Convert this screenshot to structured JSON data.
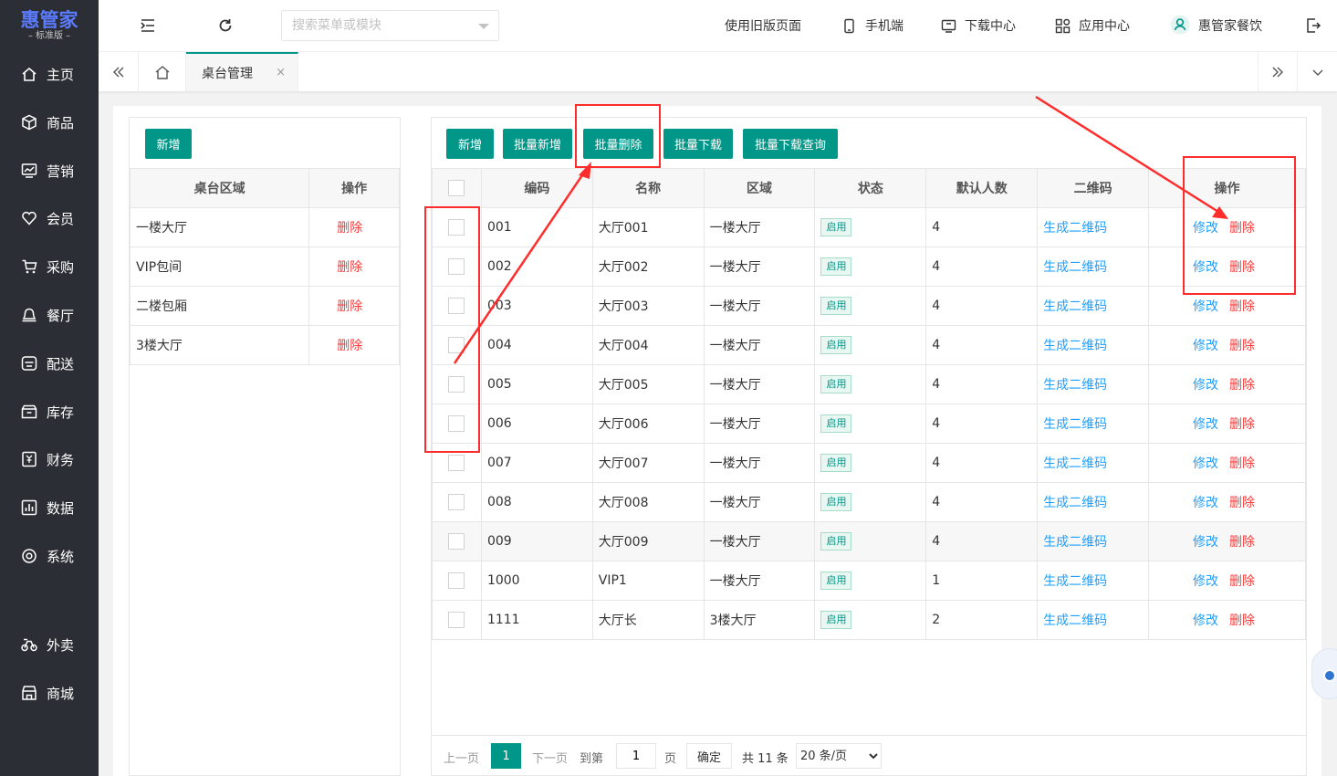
{
  "app": {
    "logo_main": "惠管家",
    "logo_sub": "– 标准版 –"
  },
  "sidebar": {
    "items": [
      {
        "label": "主页",
        "icon": "home-icon"
      },
      {
        "label": "商品",
        "icon": "box-icon"
      },
      {
        "label": "营销",
        "icon": "chart-icon"
      },
      {
        "label": "会员",
        "icon": "heart-icon"
      },
      {
        "label": "采购",
        "icon": "cart-icon"
      },
      {
        "label": "餐厅",
        "icon": "bell-icon"
      },
      {
        "label": "配送",
        "icon": "delivery-icon"
      },
      {
        "label": "库存",
        "icon": "warehouse-icon"
      },
      {
        "label": "财务",
        "icon": "finance-icon"
      },
      {
        "label": "数据",
        "icon": "data-icon"
      },
      {
        "label": "系统",
        "icon": "settings-icon"
      },
      {
        "label": "外卖",
        "icon": "bike-icon"
      },
      {
        "label": "商城",
        "icon": "store-icon"
      }
    ]
  },
  "header": {
    "search_placeholder": "搜索菜单或模块",
    "old_page": "使用旧版页面",
    "mobile": "手机端",
    "download": "下载中心",
    "apps": "应用中心",
    "user": "惠管家餐饮"
  },
  "tabs": {
    "active_label": "桌台管理",
    "close": "×"
  },
  "left": {
    "add_label": "新增",
    "columns": [
      "桌台区域",
      "操作"
    ],
    "rows": [
      {
        "name": "一楼大厅",
        "action": "删除"
      },
      {
        "name": "VIP包间",
        "action": "删除"
      },
      {
        "name": "二楼包厢",
        "action": "删除"
      },
      {
        "name": "3楼大厅",
        "action": "删除"
      }
    ]
  },
  "right": {
    "buttons": [
      "新增",
      "批量新增",
      "批量删除",
      "批量下载",
      "批量下载查询"
    ],
    "columns": [
      "编码",
      "名称",
      "区域",
      "状态",
      "默认人数",
      "二维码",
      "操作"
    ],
    "edit_label": "修改",
    "delete_label": "删除",
    "qr_label": "生成二维码",
    "rows": [
      {
        "code": "001",
        "name": "大厅001",
        "area": "一楼大厅",
        "status": "启用",
        "people": "4"
      },
      {
        "code": "002",
        "name": "大厅002",
        "area": "一楼大厅",
        "status": "启用",
        "people": "4"
      },
      {
        "code": "003",
        "name": "大厅003",
        "area": "一楼大厅",
        "status": "启用",
        "people": "4"
      },
      {
        "code": "004",
        "name": "大厅004",
        "area": "一楼大厅",
        "status": "启用",
        "people": "4"
      },
      {
        "code": "005",
        "name": "大厅005",
        "area": "一楼大厅",
        "status": "启用",
        "people": "4"
      },
      {
        "code": "006",
        "name": "大厅006",
        "area": "一楼大厅",
        "status": "启用",
        "people": "4"
      },
      {
        "code": "007",
        "name": "大厅007",
        "area": "一楼大厅",
        "status": "启用",
        "people": "4"
      },
      {
        "code": "008",
        "name": "大厅008",
        "area": "一楼大厅",
        "status": "启用",
        "people": "4"
      },
      {
        "code": "009",
        "name": "大厅009",
        "area": "一楼大厅",
        "status": "启用",
        "people": "4"
      },
      {
        "code": "1000",
        "name": "VIP1",
        "area": "一楼大厅",
        "status": "启用",
        "people": "1"
      },
      {
        "code": "1111",
        "name": "大厅长",
        "area": "3楼大厅",
        "status": "启用",
        "people": "2"
      }
    ]
  },
  "pager": {
    "prev": "上一页",
    "current": "1",
    "next": "下一页",
    "goto": "到第",
    "page_value": "1",
    "page_unit": "页",
    "confirm": "确定",
    "total": "共 11 条",
    "page_size": "20 条/页"
  },
  "colors": {
    "primary": "#009688",
    "danger": "#ff3a3a",
    "link": "#1e9fff",
    "annotation": "#ff2c2c",
    "sidebar": "#2b2e34"
  }
}
